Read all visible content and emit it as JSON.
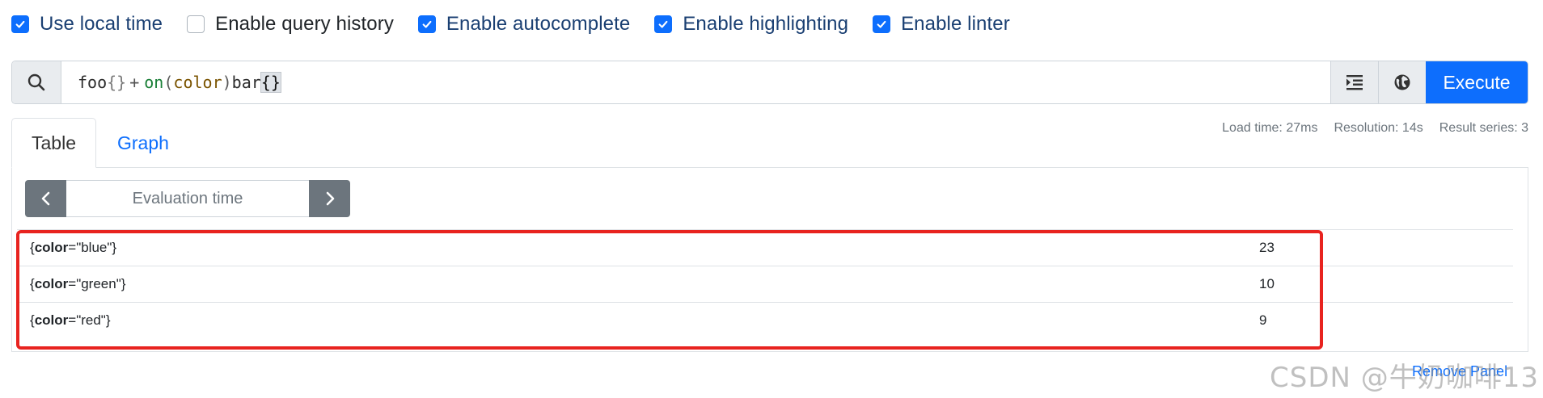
{
  "options": [
    {
      "label": "Use local time",
      "checked": true
    },
    {
      "label": "Enable query history",
      "checked": false
    },
    {
      "label": "Enable autocomplete",
      "checked": true
    },
    {
      "label": "Enable highlighting",
      "checked": true
    },
    {
      "label": "Enable linter",
      "checked": true
    }
  ],
  "query": {
    "metric1": "foo",
    "brace1": "{}",
    "operator": "+",
    "keyword": "on",
    "paren_open": "(",
    "label": "color",
    "paren_close": ")",
    "metric2": "bar",
    "brace2": "{}"
  },
  "execute_label": "Execute",
  "tabs": {
    "table": "Table",
    "graph": "Graph"
  },
  "stats": {
    "load_time": "Load time: 27ms",
    "resolution": "Resolution: 14s",
    "result_series": "Result series: 3"
  },
  "eval_placeholder": "Evaluation time",
  "results": [
    {
      "key": "color",
      "value_str": "\"blue\"",
      "value": "23"
    },
    {
      "key": "color",
      "value_str": "\"green\"",
      "value": "10"
    },
    {
      "key": "color",
      "value_str": "\"red\"",
      "value": "9"
    }
  ],
  "remove_panel": "Remove Panel",
  "watermark": "CSDN @牛奶咖啡13",
  "colors": {
    "accent": "#0d6efd",
    "highlight_border": "#e8231f",
    "nav_button": "#6c757d"
  }
}
